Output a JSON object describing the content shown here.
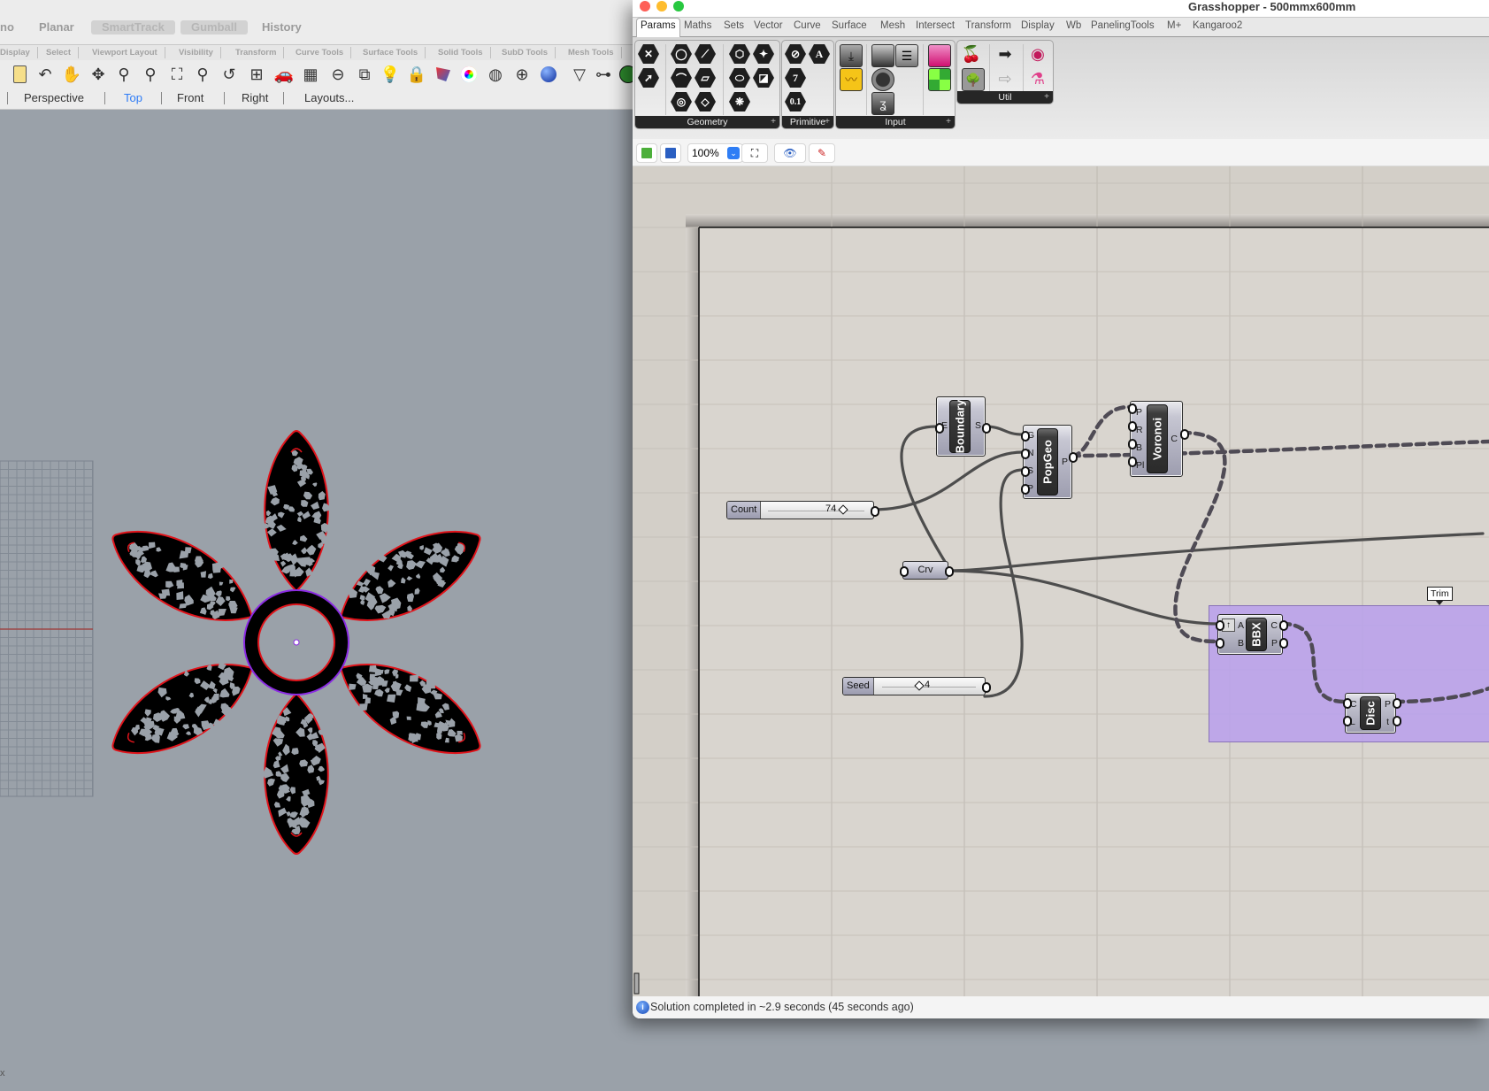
{
  "rhino": {
    "toggles": [
      "no",
      "Planar",
      "SmartTrack",
      "Gumball",
      "History"
    ],
    "toolbar_tabs": [
      "Display",
      "Select",
      "Viewport Layout",
      "Visibility",
      "Transform",
      "Curve Tools",
      "Surface Tools",
      "Solid Tools",
      "SubD Tools",
      "Mesh Tools"
    ],
    "toolbar_icons": [
      "clipboard-icon",
      "undo-icon",
      "pan-hand-icon",
      "rotate-view-icon",
      "zoom-icon",
      "zoom-window-icon",
      "zoom-extents-icon",
      "zoom-selected-icon",
      "undo-view-icon",
      "four-viewports-icon",
      "car-icon",
      "grid-icon",
      "snap-icon",
      "shapes-icon",
      "light-bulb-icon",
      "lock-icon",
      "layer-icon",
      "color-wheel-icon",
      "sphere-wire-icon",
      "sphere-grid-icon",
      "blue-sphere-icon",
      "render-icon",
      "tree-layout-icon",
      "grasshopper-icon"
    ],
    "viewport_tabs": [
      "Perspective",
      "Top",
      "Front",
      "Right",
      "Layouts..."
    ],
    "active_viewport": "Top",
    "axis_label": "x",
    "colors": {
      "petal_outline": "#e0141b",
      "ring_outline": "#8a2be2",
      "petal_fill": "#000000",
      "hole": "#9aa1a9",
      "viewport_bg": "#9aa1a9",
      "x_axis": "#9c4646"
    }
  },
  "grasshopper": {
    "title": "Grasshopper - 500mmx600mm",
    "menu_tabs": [
      "Params",
      "Maths",
      "Sets",
      "Vector",
      "Curve",
      "Surface",
      "Mesh",
      "Intersect",
      "Transform",
      "Display",
      "Wb",
      "PanelingTools",
      "M+",
      "Kangaroo2"
    ],
    "active_tab": "Params",
    "panels": [
      {
        "label": "Geometry",
        "icons": [
          "point-param-icon",
          "circle-param-icon",
          "line-param-icon",
          "box-param-icon",
          "brep-param-icon",
          "vector-param-icon",
          "arc-param-icon",
          "rectangle-param-icon",
          "surface-param-icon",
          "twisted-box-param-icon",
          "curve-param-icon",
          "plane-param-icon",
          "mesh-param-icon"
        ]
      },
      {
        "label": "Primitive",
        "icons": [
          "boolean-param-icon",
          "text-param-icon",
          "integer-param-icon",
          "number-param-icon"
        ]
      },
      {
        "label": "Input",
        "icons": [
          "data-input-icon",
          "toggle-icon",
          "value-list-icon",
          "gradient-icon",
          "graph-mapper-icon",
          "dial-icon",
          "digit-scroller-icon",
          "colour-swatch-icon"
        ]
      },
      {
        "label": "Util",
        "icons": [
          "cherry-picker-icon",
          "relay-icon",
          "tree-icon",
          "relay-outline-icon",
          "disc-icon",
          "flask-icon"
        ]
      }
    ],
    "toolbar": {
      "zoom": "100%",
      "buttons": [
        "open-file-icon",
        "save-file-icon",
        "zoom-extents-icon",
        "preview-eye-icon",
        "sketch-pen-icon"
      ]
    },
    "canvas": {
      "components": [
        {
          "id": "boundary",
          "label": "Boundary",
          "inputs": [
            "E"
          ],
          "outputs": [
            "S"
          ]
        },
        {
          "id": "popgeo",
          "label": "PopGeo",
          "inputs": [
            "G",
            "N",
            "S",
            "P"
          ],
          "outputs": [
            "P"
          ]
        },
        {
          "id": "voronoi",
          "label": "Voronoi",
          "inputs": [
            "P",
            "R",
            "B",
            "Pl"
          ],
          "outputs": [
            "C"
          ]
        },
        {
          "id": "bbx",
          "label": "BBX",
          "inputs": [
            "A",
            "B"
          ],
          "outputs": [
            "C",
            "P"
          ]
        },
        {
          "id": "disc",
          "label": "Disc",
          "inputs": [
            "C",
            "L"
          ],
          "outputs": [
            "P",
            "t"
          ]
        }
      ],
      "sliders": [
        {
          "id": "count",
          "label": "Count",
          "value": "74"
        },
        {
          "id": "seed",
          "label": "Seed",
          "value": "4"
        }
      ],
      "params": [
        {
          "id": "crv",
          "label": "Crv"
        }
      ],
      "groups": [
        {
          "id": "trim",
          "label": "Trim",
          "color": "#b9a0ec"
        }
      ]
    },
    "status": "Solution completed in ~2.9 seconds (45 seconds ago)"
  }
}
